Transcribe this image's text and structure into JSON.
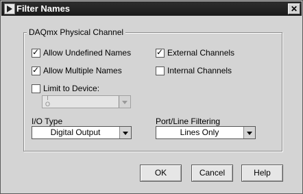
{
  "window": {
    "title": "Filter Names"
  },
  "group": {
    "title": "DAQmx Physical Channel"
  },
  "checkboxes": {
    "allow_undefined": {
      "label": "Allow Undefined Names",
      "checked": true
    },
    "external_channels": {
      "label": "External Channels",
      "checked": true
    },
    "allow_multiple": {
      "label": "Allow Multiple Names",
      "checked": true
    },
    "internal_channels": {
      "label": "Internal Channels",
      "checked": false
    },
    "limit_to_device": {
      "label": "Limit to Device:",
      "checked": false
    }
  },
  "device_select": {
    "value": "",
    "glyph_top": "I",
    "glyph_bottom": "O"
  },
  "io_type": {
    "label": "I/O Type",
    "value": "Digital Output"
  },
  "port_line": {
    "label": "Port/Line Filtering",
    "value": "Lines Only"
  },
  "buttons": {
    "ok": "OK",
    "cancel": "Cancel",
    "help": "Help"
  },
  "icons": {
    "app": "labview-icon",
    "close": "close-icon"
  }
}
